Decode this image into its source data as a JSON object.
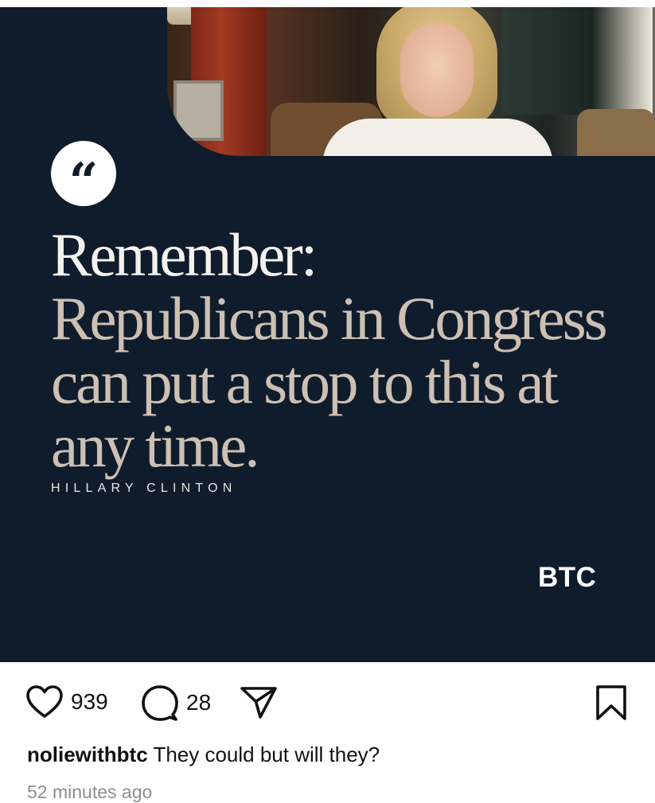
{
  "post": {
    "quote_lead": "Remember:",
    "quote_rest": "Republicans in Congress can put a stop to this at any time.",
    "author": "HILLARY CLINTON",
    "brand": "BTC",
    "colors": {
      "card_bg": "#0f1c2c",
      "lead_text": "#f4f2ee",
      "rest_text": "#cdbfb2"
    }
  },
  "actions": {
    "likes": "939",
    "comments": "28",
    "icons": [
      "heart-icon",
      "comment-icon",
      "share-icon",
      "bookmark-icon"
    ]
  },
  "caption": {
    "username": "noliewithbtc",
    "text": "They could but will they?"
  },
  "timestamp": "52 minutes ago"
}
